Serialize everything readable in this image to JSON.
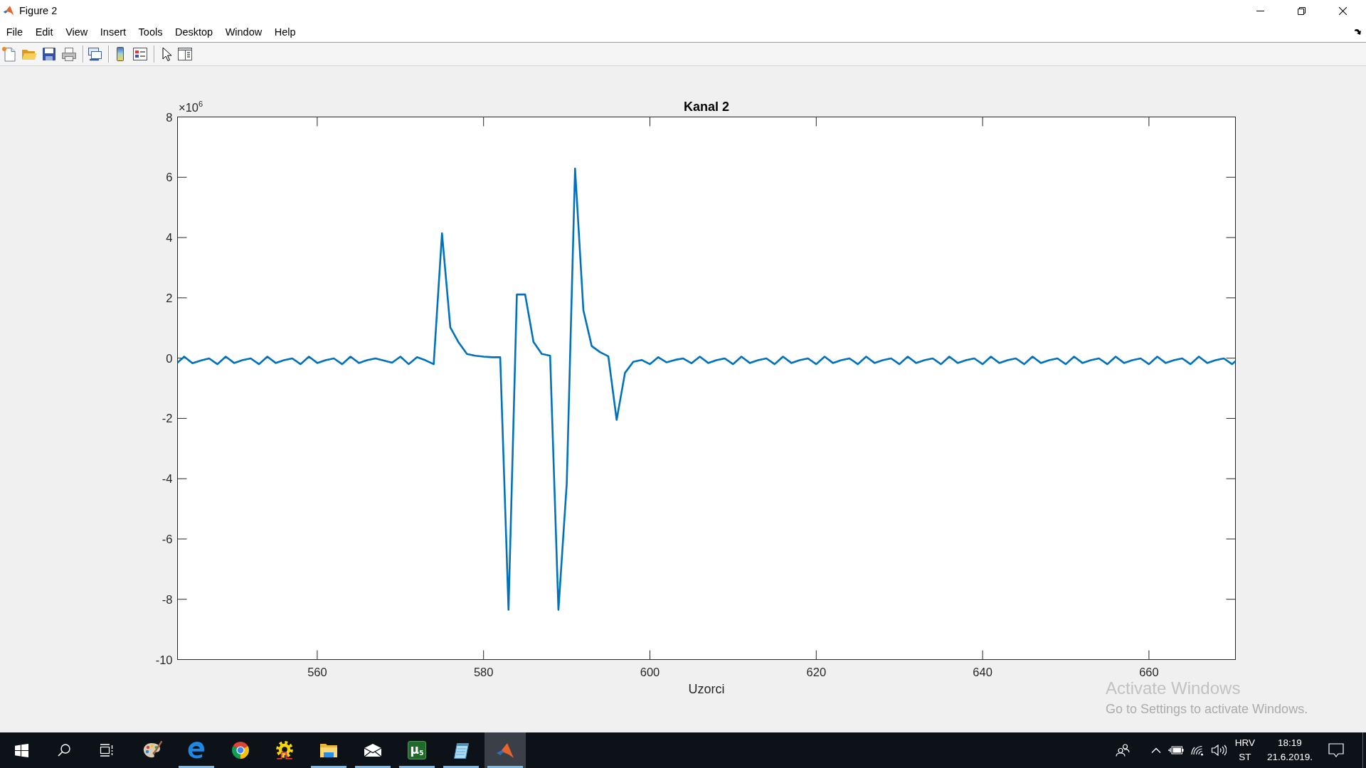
{
  "window": {
    "title": "Figure 2"
  },
  "menu": [
    "File",
    "Edit",
    "View",
    "Insert",
    "Tools",
    "Desktop",
    "Window",
    "Help"
  ],
  "figure": {
    "axis_multiplier": "×10$^{6}$",
    "chart_data": {
      "type": "line",
      "title": "Kanal 2",
      "xlabel": "Uzorci",
      "x": [
        543.2,
        544,
        545,
        546,
        547,
        548,
        549,
        550,
        551,
        552,
        553,
        554,
        555,
        556,
        557,
        558,
        559,
        560,
        561,
        562,
        563,
        564,
        565,
        566,
        567,
        568,
        569,
        570,
        571,
        572,
        573,
        574,
        575,
        576,
        577,
        578,
        579,
        580,
        581,
        582,
        583,
        584,
        585,
        586,
        587,
        588,
        589,
        590,
        591,
        592,
        593,
        594,
        595,
        596,
        597,
        598,
        599,
        600,
        601,
        602,
        603,
        604,
        605,
        606,
        607,
        608,
        609,
        610,
        611,
        612,
        613,
        614,
        615,
        616,
        617,
        618,
        619,
        620,
        621,
        622,
        623,
        624,
        625,
        626,
        627,
        628,
        629,
        630,
        631,
        632,
        633,
        634,
        635,
        636,
        637,
        638,
        639,
        640,
        641,
        642,
        643,
        644,
        645,
        646,
        647,
        648,
        649,
        650,
        651,
        652,
        653,
        654,
        655,
        656,
        657,
        658,
        659,
        660,
        661,
        662,
        663,
        664,
        665,
        666,
        667,
        668,
        669,
        670,
        670.4
      ],
      "series": [
        {
          "color": "#0072bd",
          "values": [
            -0.15,
            0.05,
            -0.17,
            -0.08,
            -0.01,
            -0.2,
            0.05,
            -0.16,
            -0.07,
            -0.01,
            -0.2,
            0.05,
            -0.16,
            -0.07,
            -0.01,
            -0.2,
            0.05,
            -0.16,
            -0.07,
            -0.01,
            -0.2,
            0.05,
            -0.16,
            -0.07,
            -0.01,
            -0.08,
            -0.15,
            0.05,
            -0.2,
            0.03,
            -0.07,
            -0.2,
            4.14,
            1.02,
            0.52,
            0.14,
            0.08,
            0.05,
            0.03,
            0.03,
            -8.35,
            2.11,
            2.11,
            0.54,
            0.14,
            0.08,
            -8.35,
            -4.16,
            6.29,
            1.59,
            0.4,
            0.2,
            0.06,
            -2.05,
            -0.49,
            -0.12,
            -0.06,
            -0.2,
            0.03,
            -0.14,
            -0.06,
            -0.01,
            -0.17,
            0.05,
            -0.16,
            -0.07,
            -0.01,
            -0.2,
            0.05,
            -0.16,
            -0.07,
            -0.01,
            -0.2,
            0.05,
            -0.16,
            -0.07,
            -0.01,
            -0.2,
            0.05,
            -0.16,
            -0.07,
            -0.01,
            -0.2,
            0.05,
            -0.16,
            -0.07,
            -0.01,
            -0.2,
            0.05,
            -0.16,
            -0.07,
            -0.01,
            -0.2,
            0.05,
            -0.16,
            -0.07,
            -0.01,
            -0.2,
            0.05,
            -0.16,
            -0.07,
            -0.01,
            -0.2,
            0.05,
            -0.16,
            -0.07,
            -0.01,
            -0.2,
            0.05,
            -0.16,
            -0.07,
            -0.01,
            -0.2,
            0.05,
            -0.16,
            -0.07,
            -0.01,
            -0.2,
            0.05,
            -0.16,
            -0.07,
            -0.01,
            -0.2,
            0.05,
            -0.16,
            -0.07,
            -0.01,
            -0.2,
            -0.1
          ]
        }
      ],
      "xlim": [
        543.2,
        670.4
      ],
      "ylim": [
        -10,
        8
      ],
      "xticks": [
        560,
        580,
        600,
        620,
        640,
        660
      ],
      "yticks": [
        -10,
        -8,
        -6,
        -4,
        -2,
        0,
        2,
        4,
        6,
        8
      ]
    }
  },
  "activation_notice": {
    "title": "Activate Windows",
    "message": "Go to Settings to activate Windows."
  },
  "taskbar": {
    "apps": [
      {
        "kind": "palette",
        "open": false,
        "selected": false
      },
      {
        "kind": "letter_e",
        "open": true,
        "selected": false
      },
      {
        "kind": "segmented_circle",
        "open": false,
        "selected": false
      },
      {
        "kind": "gear",
        "open": false,
        "selected": false
      },
      {
        "kind": "folder",
        "open": true,
        "selected": false
      },
      {
        "kind": "envelope",
        "open": true,
        "selected": false
      },
      {
        "kind": "tile",
        "label": "µ$_{5}$",
        "open": true,
        "selected": false
      },
      {
        "kind": "notepad",
        "open": true,
        "selected": false
      },
      {
        "kind": "peak",
        "open": true,
        "selected": true
      }
    ],
    "language": {
      "code": "HRV",
      "layout": "ST"
    },
    "clock": {
      "time": "18:19",
      "date": "21.6.2019."
    }
  }
}
